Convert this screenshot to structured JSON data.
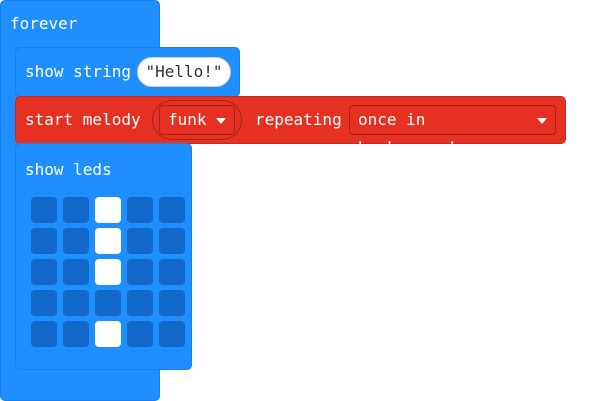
{
  "forever": {
    "label": "forever"
  },
  "show_string": {
    "label": "show string",
    "value": "\"Hello!\""
  },
  "start_melody": {
    "label": "start melody",
    "melody": "funk",
    "repeat_label": "repeating",
    "repeat_mode": "once in background"
  },
  "show_leds": {
    "label": "show leds",
    "grid": [
      [
        0,
        0,
        1,
        0,
        0
      ],
      [
        0,
        0,
        1,
        0,
        0
      ],
      [
        0,
        0,
        1,
        0,
        0
      ],
      [
        0,
        0,
        0,
        0,
        0
      ],
      [
        0,
        0,
        1,
        0,
        0
      ]
    ]
  },
  "colors": {
    "loops_blue": "#1f8fff",
    "music_red": "#e63022",
    "led_off": "#1168c8",
    "led_on": "#ffffff"
  }
}
